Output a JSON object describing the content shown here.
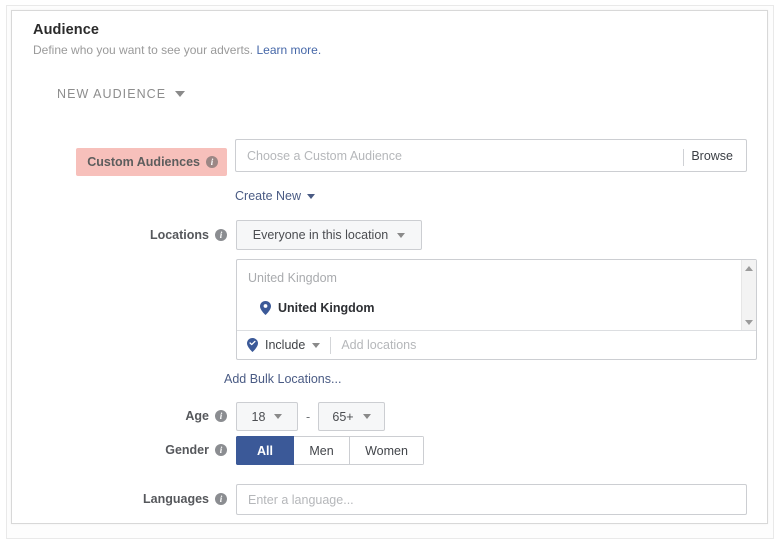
{
  "header": {
    "title": "Audience",
    "subtitle": "Define who you want to see your adverts.",
    "learn_more": "Learn more.",
    "link_color": "#4567a8"
  },
  "section": {
    "toggle_label": "NEW AUDIENCE",
    "toggle_icon": "chevron-down-icon"
  },
  "custom_audiences": {
    "label": "Custom Audiences",
    "info_icon": "info-icon",
    "highlight_color": "#f7c0bb",
    "placeholder": "Choose a Custom Audience",
    "value": "",
    "browse_label": "Browse",
    "create_new_label": "Create New",
    "create_new_icon": "chevron-down-icon"
  },
  "locations": {
    "label": "Locations",
    "info_icon": "info-icon",
    "scope_dropdown": "Everyone in this location",
    "scope_dropdown_icon": "chevron-down-icon",
    "list_header": "United Kingdom",
    "selected_items": [
      {
        "name": "United Kingdom",
        "icon": "map-pin-icon"
      }
    ],
    "scroll_up_icon": "scroll-up-arrow-icon",
    "scroll_down_icon": "scroll-down-arrow-icon",
    "include_label": "Include",
    "include_icon": "map-pin-check-icon",
    "include_caret": "chevron-down-icon",
    "add_placeholder": "Add locations",
    "add_value": "",
    "bulk_link": "Add Bulk Locations..."
  },
  "age": {
    "label": "Age",
    "info_icon": "info-icon",
    "min": "18",
    "max": "65+",
    "separator": "-",
    "dropdown_icon": "chevron-down-icon"
  },
  "gender": {
    "label": "Gender",
    "info_icon": "info-icon",
    "options": [
      "All",
      "Men",
      "Women"
    ],
    "selected": "All",
    "selected_color": "#3b5998"
  },
  "languages": {
    "label": "Languages",
    "info_icon": "info-icon",
    "placeholder": "Enter a language...",
    "value": ""
  }
}
